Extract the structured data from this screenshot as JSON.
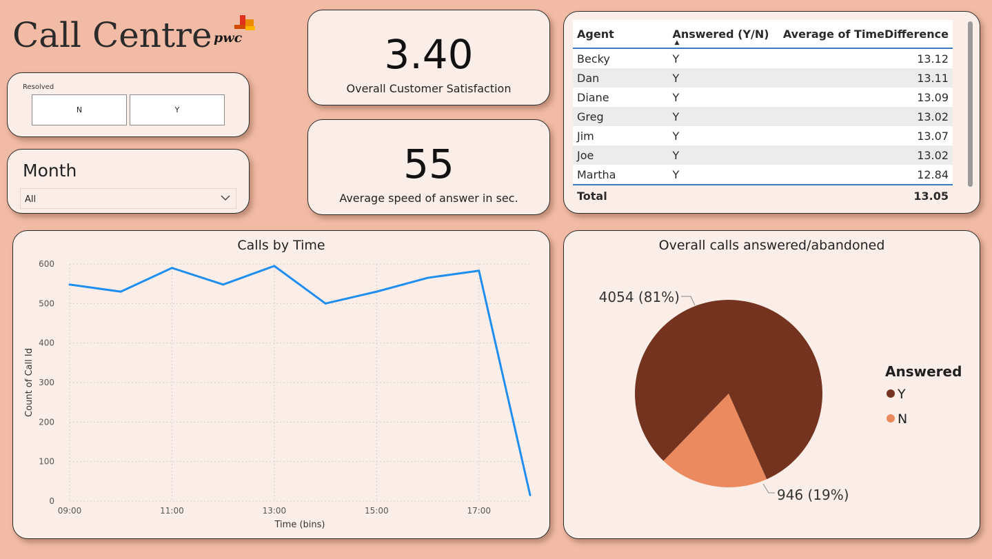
{
  "header": {
    "title": "Call Centre",
    "logo_text": "pwc"
  },
  "resolved_slicer": {
    "label": "Resolved",
    "options": [
      "N",
      "Y"
    ]
  },
  "month_slicer": {
    "label": "Month",
    "value": "All"
  },
  "kpis": [
    {
      "value": "3.40",
      "label": "Overall Customer Satisfaction"
    },
    {
      "value": "55",
      "label": "Average speed of answer in sec."
    }
  ],
  "agent_table": {
    "columns": [
      "Agent",
      "Answered (Y/N)",
      "Average of TimeDifference"
    ],
    "rows": [
      [
        "Becky",
        "Y",
        "13.12"
      ],
      [
        "Dan",
        "Y",
        "13.11"
      ],
      [
        "Diane",
        "Y",
        "13.09"
      ],
      [
        "Greg",
        "Y",
        "13.02"
      ],
      [
        "Jim",
        "Y",
        "13.07"
      ],
      [
        "Joe",
        "Y",
        "13.02"
      ],
      [
        "Martha",
        "Y",
        "12.84"
      ]
    ],
    "total": [
      "Total",
      "",
      "13.05"
    ]
  },
  "chart_data": [
    {
      "type": "line",
      "title": "Calls by Time",
      "xlabel": "Time (bins)",
      "ylabel": "Count of Call Id",
      "x": [
        "09:00",
        "10:00",
        "11:00",
        "12:00",
        "13:00",
        "14:00",
        "15:00",
        "16:00",
        "17:00",
        "18:00"
      ],
      "x_tick_labels": [
        "09:00",
        "11:00",
        "13:00",
        "15:00",
        "17:00"
      ],
      "series": [
        {
          "values": [
            548,
            530,
            590,
            548,
            595,
            500,
            530,
            565,
            583,
            15
          ]
        }
      ],
      "ylim": [
        0,
        600
      ],
      "y_ticks": [
        0,
        100,
        200,
        300,
        400,
        500,
        600
      ],
      "grid": true,
      "color": "#1f8ef1"
    },
    {
      "type": "pie",
      "title": "Overall calls answered/abandoned",
      "legend_title": "Answered",
      "legend_position": "right",
      "slices": [
        {
          "label": "Y",
          "value": 4054,
          "data_label": "4054 (81%)",
          "color": "#73331e"
        },
        {
          "label": "N",
          "value": 946,
          "data_label": "946 (19%)",
          "color": "#ec8a5f"
        }
      ]
    }
  ]
}
